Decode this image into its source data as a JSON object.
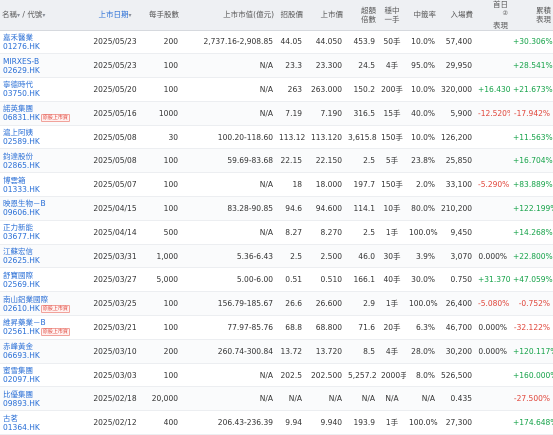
{
  "headers": {
    "name": "名稱",
    "name_arrow": "▾",
    "code": "代號",
    "code_arrow": "▾",
    "date": "上市日期",
    "date_arrow": "▾",
    "lot": "每手股數",
    "cap": "上市市值(億元)",
    "price": "招股價",
    "listprice": "上市價",
    "oversub_1": "超額",
    "oversub_2": "倍數",
    "onelot_1": "穩中",
    "onelot_2": "一手",
    "rate": "中籤率",
    "entry": "入場費",
    "d1_1": "首日",
    "d1_2": "表現",
    "d1_sup": "②",
    "acc_1": "累積",
    "acc_2": "表現"
  },
  "rows": [
    {
      "name": "嘉禾醫業",
      "code": "01276.HK",
      "badge": "",
      "date": "2025/05/23",
      "lot": "200",
      "cap": "2,737.16-2,908.85",
      "price": "44.05",
      "listprice": "44.050",
      "oversub": "453.9",
      "onelot": "50手",
      "rate": "10.0%",
      "entry": "57,400",
      "d1": "",
      "d1_cls": "zero",
      "acc": "+30.306%",
      "acc_cls": "pos"
    },
    {
      "name": "MIRXES-B",
      "code": "02629.HK",
      "badge": "",
      "date": "2025/05/23",
      "lot": "100",
      "cap": "N/A",
      "price": "23.3",
      "listprice": "23.300",
      "oversub": "24.5",
      "onelot": "4手",
      "rate": "95.0%",
      "entry": "29,950",
      "d1": "",
      "d1_cls": "zero",
      "acc": "+28.541%",
      "acc_cls": "pos"
    },
    {
      "name": "寧德時代",
      "code": "03750.HK",
      "badge": "",
      "date": "2025/05/20",
      "lot": "100",
      "cap": "N/A",
      "price": "263",
      "listprice": "263.000",
      "oversub": "150.2",
      "onelot": "200手",
      "rate": "10.0%",
      "entry": "320,000",
      "d1": "+16.430%",
      "d1_cls": "pos",
      "acc": "+21.673%",
      "acc_cls": "pos"
    },
    {
      "name": "諾英集團",
      "code": "06831.HK",
      "badge": "原股上市資",
      "date": "2025/05/16",
      "lot": "1000",
      "cap": "N/A",
      "price": "7.19",
      "listprice": "7.190",
      "oversub": "316.5",
      "onelot": "15手",
      "rate": "40.0%",
      "entry": "5,900",
      "d1": "-12.520%",
      "d1_cls": "neg",
      "acc": "-17.942%",
      "acc_cls": "neg"
    },
    {
      "name": "滬上阿姨",
      "code": "02589.HK",
      "badge": "",
      "date": "2025/05/08",
      "lot": "30",
      "cap": "100.20-118.60",
      "price": "113.12",
      "listprice": "113.120",
      "oversub": "3,615.8",
      "onelot": "150手",
      "rate": "10.0%",
      "entry": "126,200",
      "d1": "",
      "d1_cls": "zero",
      "acc": "+11.563%",
      "acc_cls": "pos"
    },
    {
      "name": "鈞達股份",
      "code": "02865.HK",
      "badge": "",
      "date": "2025/05/08",
      "lot": "100",
      "cap": "59.69-83.68",
      "price": "22.15",
      "listprice": "22.150",
      "oversub": "2.5",
      "onelot": "5手",
      "rate": "23.8%",
      "entry": "25,850",
      "d1": "",
      "d1_cls": "zero",
      "acc": "+16.704%",
      "acc_cls": "pos"
    },
    {
      "name": "博雲箱",
      "code": "01333.HK",
      "badge": "",
      "date": "2025/05/07",
      "lot": "100",
      "cap": "N/A",
      "price": "18",
      "listprice": "18.000",
      "oversub": "197.7",
      "onelot": "150手",
      "rate": "2.0%",
      "entry": "33,100",
      "d1": "-5.290%",
      "d1_cls": "neg",
      "acc": "+83.889%",
      "acc_cls": "pos"
    },
    {
      "name": "映恩生物－B",
      "code": "09606.HK",
      "badge": "",
      "date": "2025/04/15",
      "lot": "100",
      "cap": "83.28-90.85",
      "price": "94.6",
      "listprice": "94.600",
      "oversub": "114.1",
      "onelot": "10手",
      "rate": "80.0%",
      "entry": "210,200",
      "d1": "",
      "d1_cls": "zero",
      "acc": "+122.199%",
      "acc_cls": "pos"
    },
    {
      "name": "正力新能",
      "code": "03677.HK",
      "badge": "",
      "date": "2025/04/14",
      "lot": "500",
      "cap": "N/A",
      "price": "8.27",
      "listprice": "8.270",
      "oversub": "2.5",
      "onelot": "1手",
      "rate": "100.0%",
      "entry": "9,450",
      "d1": "",
      "d1_cls": "zero",
      "acc": "+14.268%",
      "acc_cls": "pos"
    },
    {
      "name": "江蘇宏信",
      "code": "02625.HK",
      "badge": "",
      "date": "2025/03/31",
      "lot": "1,000",
      "cap": "5.36-6.43",
      "price": "2.5",
      "listprice": "2.500",
      "oversub": "46.0",
      "onelot": "30手",
      "rate": "3.9%",
      "entry": "3,070",
      "d1": "0.000%",
      "d1_cls": "zero",
      "acc": "+22.800%",
      "acc_cls": "pos"
    },
    {
      "name": "舒寶國際",
      "code": "02569.HK",
      "badge": "",
      "date": "2025/03/27",
      "lot": "5,000",
      "cap": "5.00-6.00",
      "price": "0.51",
      "listprice": "0.510",
      "oversub": "166.1",
      "onelot": "40手",
      "rate": "30.0%",
      "entry": "0.750",
      "d1": "+31.370%",
      "d1_cls": "pos",
      "acc": "+47.059%",
      "acc_cls": "pos"
    },
    {
      "name": "南山鋁業國際",
      "code": "02610.HK",
      "badge": "原股上市資",
      "date": "2025/03/25",
      "lot": "100",
      "cap": "156.79-185.67",
      "price": "26.6",
      "listprice": "26.600",
      "oversub": "2.9",
      "onelot": "1手",
      "rate": "100.0%",
      "entry": "26,400",
      "d1": "-5.080%",
      "d1_cls": "neg",
      "acc": "-0.752%",
      "acc_cls": "neg"
    },
    {
      "name": "維昇藥業－B",
      "code": "02561.HK",
      "badge": "原股上市資",
      "date": "2025/03/21",
      "lot": "100",
      "cap": "77.97-85.76",
      "price": "68.8",
      "listprice": "68.800",
      "oversub": "71.6",
      "onelot": "20手",
      "rate": "6.3%",
      "entry": "46,700",
      "d1": "0.000%",
      "d1_cls": "zero",
      "acc": "-32.122%",
      "acc_cls": "neg"
    },
    {
      "name": "赤峰黃金",
      "code": "06693.HK",
      "badge": "",
      "date": "2025/03/10",
      "lot": "200",
      "cap": "260.74-300.84",
      "price": "13.72",
      "listprice": "13.720",
      "oversub": "8.5",
      "onelot": "4手",
      "rate": "28.0%",
      "entry": "30,200",
      "d1": "0.000%",
      "d1_cls": "zero",
      "acc": "+120.117%",
      "acc_cls": "pos"
    },
    {
      "name": "蜜雪集團",
      "code": "02097.HK",
      "badge": "",
      "date": "2025/03/03",
      "lot": "100",
      "cap": "N/A",
      "price": "202.5",
      "listprice": "202.500",
      "oversub": "5,257.2",
      "onelot": "2000手",
      "rate": "8.0%",
      "entry": "526,500",
      "d1": "",
      "d1_cls": "zero",
      "acc": "+160.000%",
      "acc_cls": "pos"
    },
    {
      "name": "比優集團",
      "code": "09893.HK",
      "badge": "",
      "date": "2025/02/18",
      "lot": "20,000",
      "cap": "N/A",
      "price": "N/A",
      "listprice": "N/A",
      "oversub": "N/A",
      "onelot": "N/A",
      "rate": "N/A",
      "entry": "0.435",
      "d1": "",
      "d1_cls": "zero",
      "acc": "-27.500%",
      "acc_cls": "neg"
    },
    {
      "name": "古茗",
      "code": "01364.HK",
      "badge": "",
      "date": "2025/02/12",
      "lot": "400",
      "cap": "206.43-236.39",
      "price": "9.94",
      "listprice": "9.940",
      "oversub": "193.9",
      "onelot": "1手",
      "rate": "100.0%",
      "entry": "27,300",
      "d1": "",
      "d1_cls": "zero",
      "acc": "+174.648%",
      "acc_cls": "pos"
    }
  ]
}
